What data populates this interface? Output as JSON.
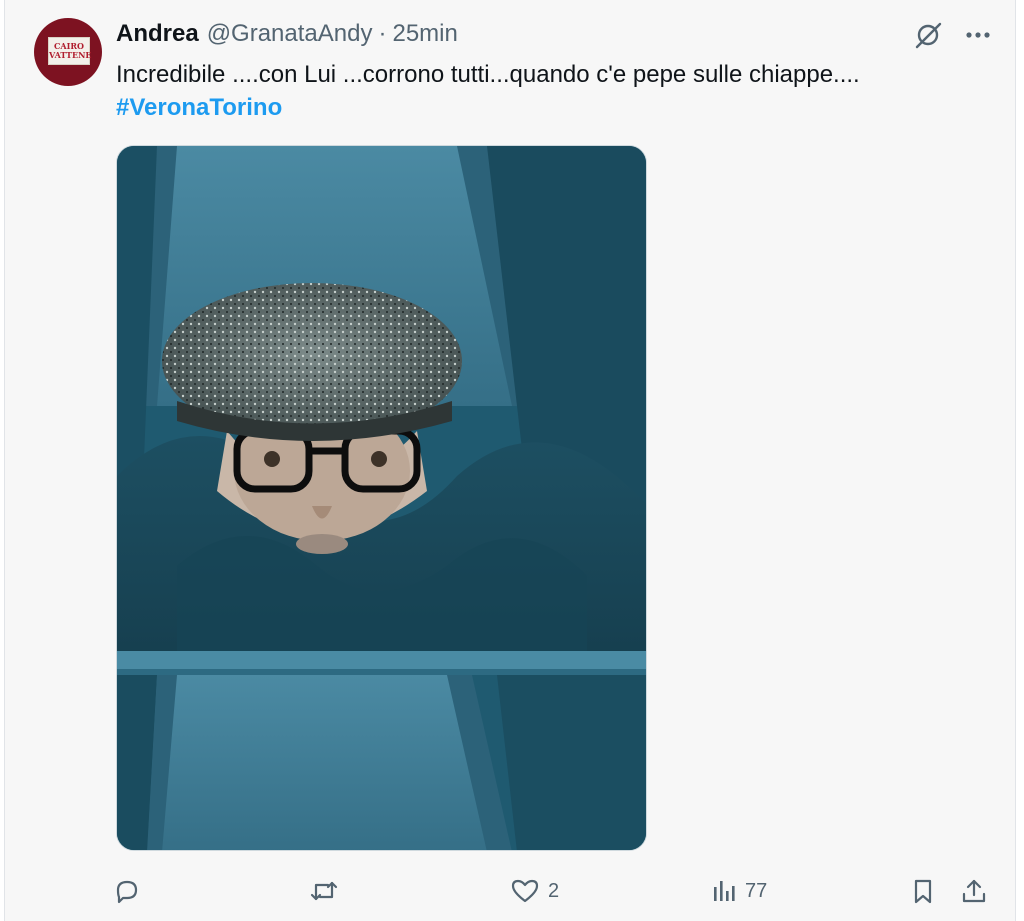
{
  "tweet": {
    "author_name": "Andrea",
    "handle": "@GranataAndy",
    "separator": "·",
    "time": "25min",
    "avatar_text_line1": "CAIRO",
    "avatar_text_line2": "VATTENE",
    "text": "Incredibile ....con Lui ...corrono tutti...quando c'e pepe sulle chiappe....",
    "hashtag": "#VeronaTorino"
  },
  "icons": {
    "grok": "grok-icon",
    "more": "more-icon",
    "reply": "reply-icon",
    "retweet": "retweet-icon",
    "like": "like-icon",
    "views": "views-icon",
    "bookmark": "bookmark-icon",
    "share": "share-icon"
  },
  "actions": {
    "like_count": "2",
    "views_count": "77"
  },
  "colors": {
    "link": "#1d9bf0",
    "secondary_text": "#536471",
    "avatar_bg": "#7d1221"
  }
}
